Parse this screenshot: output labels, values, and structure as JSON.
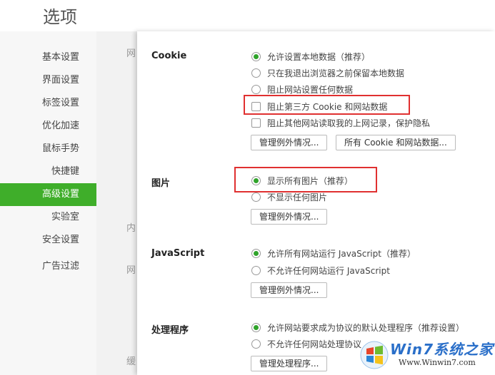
{
  "window": {
    "title": "选项"
  },
  "sidebar": {
    "items": [
      {
        "label": "基本设置",
        "active": false
      },
      {
        "label": "界面设置",
        "active": false
      },
      {
        "label": "标签设置",
        "active": false
      },
      {
        "label": "优化加速",
        "active": false
      },
      {
        "label": "鼠标手势",
        "active": false
      },
      {
        "label": "快捷键",
        "active": false
      },
      {
        "label": "高级设置",
        "active": true
      },
      {
        "label": "实验室",
        "active": false
      },
      {
        "label": "安全设置",
        "active": false
      },
      {
        "label": "广告过滤",
        "active": false
      }
    ]
  },
  "background_fragments": [
    "网",
    "内",
    "网",
    "缓"
  ],
  "content": {
    "cookie": {
      "title": "Cookie",
      "options": [
        "允许设置本地数据（推荐）",
        "只在我退出浏览器之前保留本地数据",
        "阻止网站设置任何数据",
        "阻止第三方 Cookie 和网站数据",
        "阻止其他网站读取我的上网记录，保护隐私"
      ],
      "manage_button": "管理例外情况...",
      "all_data_button": "所有 Cookie 和网站数据..."
    },
    "images": {
      "title": "图片",
      "options": [
        "显示所有图片（推荐）",
        "不显示任何图片"
      ],
      "manage_button": "管理例外情况..."
    },
    "javascript": {
      "title": "JavaScript",
      "options": [
        "允许所有网站运行 JavaScript（推荐）",
        "不允许任何网站运行 JavaScript"
      ],
      "manage_button": "管理例外情况..."
    },
    "handlers": {
      "title": "处理程序",
      "options": [
        "允许网站要求成为协议的默认处理程序（推荐设置）",
        "不允许任何网站处理协议"
      ],
      "manage_button": "管理处理程序..."
    }
  },
  "watermark": {
    "brand": "Win7系统之家",
    "url": "Www.Winwin7.com"
  },
  "colors": {
    "accent": "#3fae2a",
    "radio_dot": "#2fa32a",
    "highlight": "#e03030"
  }
}
